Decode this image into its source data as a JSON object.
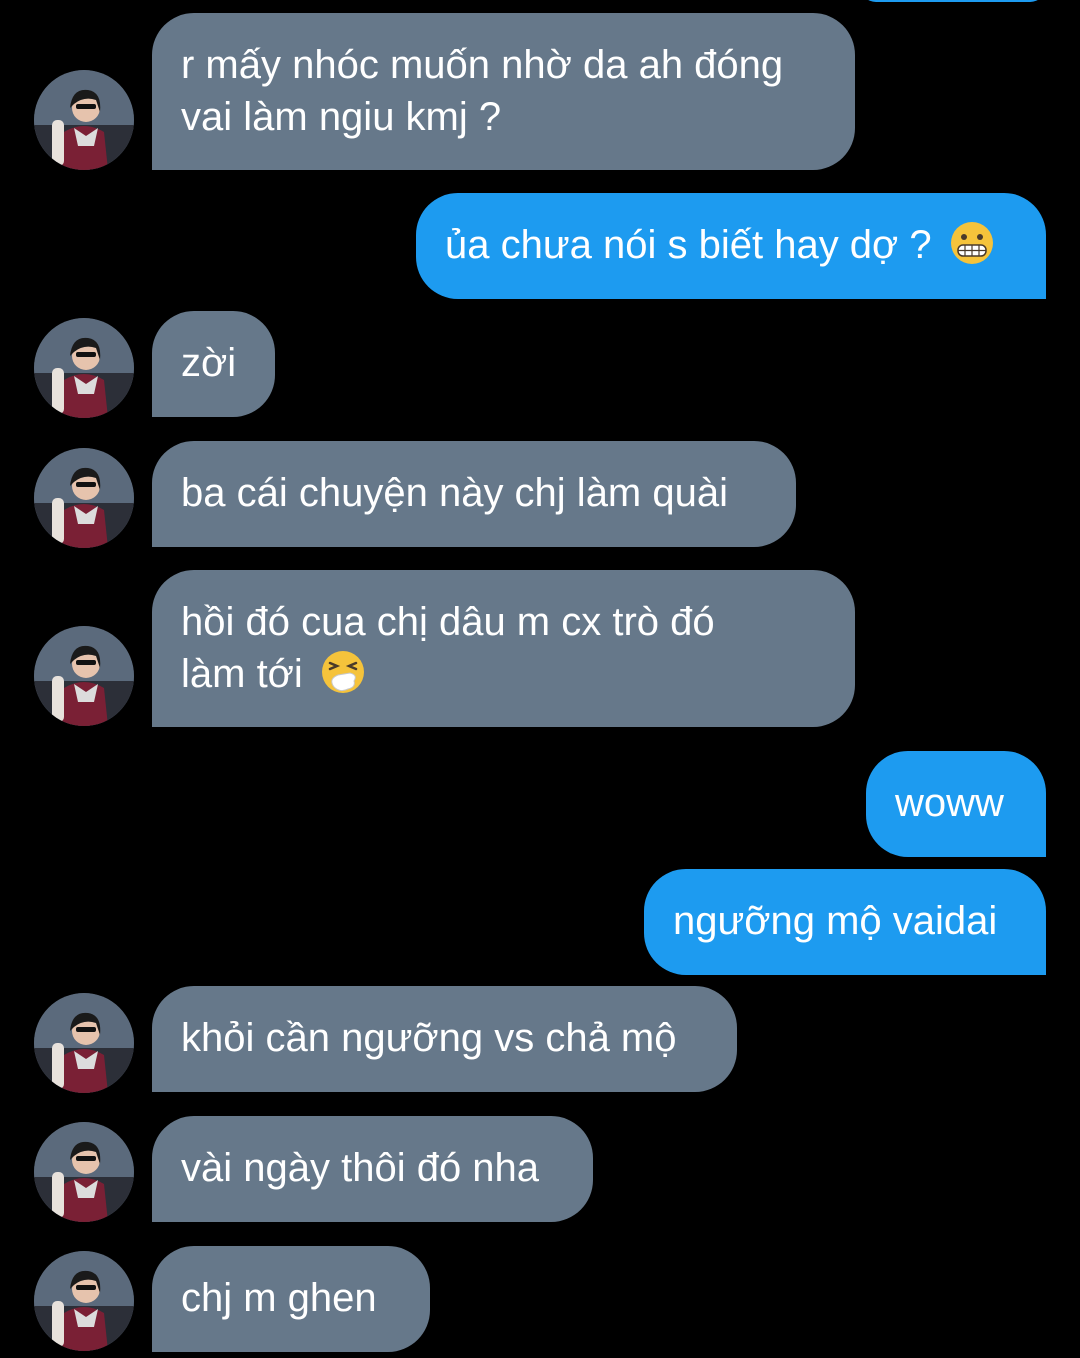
{
  "colors": {
    "background": "#000000",
    "incoming_bubble": "#66788a",
    "outgoing_bubble": "#1d9bf0",
    "text": "#ffffff"
  },
  "messages": [
    {
      "direction": "incoming",
      "lines": [
        "r mấy nhóc muốn nhờ da ah đóng",
        "vai làm ngiu kmj ?"
      ],
      "avatar": "contact-avatar"
    },
    {
      "direction": "outgoing",
      "text": "ủa chưa nói s biết hay dợ ?",
      "emoji": "grimacing-face-emoji"
    },
    {
      "direction": "incoming",
      "text": "zời",
      "avatar": "contact-avatar"
    },
    {
      "direction": "incoming",
      "text": "ba cái chuyện này chj làm quài",
      "avatar": "contact-avatar"
    },
    {
      "direction": "incoming",
      "lines": [
        "hồi đó cua chị dâu m cx trò đó",
        "làm tới"
      ],
      "emoji": "sneezing-face-emoji",
      "avatar": "contact-avatar"
    },
    {
      "direction": "outgoing",
      "text": "woww"
    },
    {
      "direction": "outgoing",
      "text": "ngưỡng mộ vaidai"
    },
    {
      "direction": "incoming",
      "text": "khỏi cần ngưỡng vs chả mộ",
      "avatar": "contact-avatar"
    },
    {
      "direction": "incoming",
      "text": "vài ngày thôi đó nha",
      "avatar": "contact-avatar"
    },
    {
      "direction": "incoming",
      "text": "chj m ghen",
      "avatar": "contact-avatar"
    }
  ]
}
